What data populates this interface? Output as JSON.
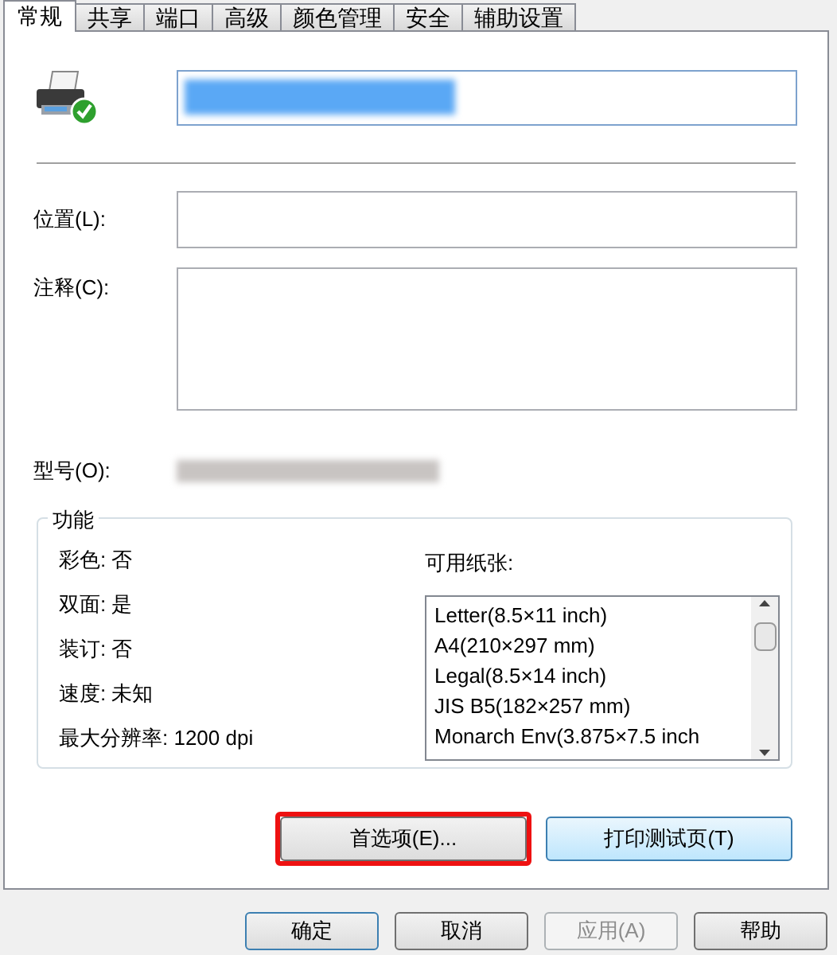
{
  "tabs": [
    {
      "label": "常规",
      "selected": true
    },
    {
      "label": "共享",
      "selected": false
    },
    {
      "label": "端口",
      "selected": false
    },
    {
      "label": "高级",
      "selected": false
    },
    {
      "label": "颜色管理",
      "selected": false
    },
    {
      "label": "安全",
      "selected": false
    },
    {
      "label": "辅助设置",
      "selected": false
    }
  ],
  "location": {
    "label": "位置(L):"
  },
  "comment": {
    "label": "注释(C):"
  },
  "model": {
    "label": "型号(O):"
  },
  "features": {
    "title": "功能",
    "items": [
      "彩色: 否",
      "双面: 是",
      "装订: 否",
      "速度: 未知",
      "最大分辨率: 1200 dpi"
    ],
    "paper_label": "可用纸张:",
    "paper_sizes": [
      "Letter(8.5×11 inch)",
      "A4(210×297 mm)",
      "Legal(8.5×14 inch)",
      "JIS B5(182×257 mm)",
      "Monarch Env(3.875×7.5 inch"
    ]
  },
  "panel_buttons": [
    {
      "label": "首选项(E)...",
      "highlighted": true
    },
    {
      "label": "打印测试页(T)",
      "highlighted": false
    }
  ],
  "dialog_buttons": [
    {
      "label": "确定",
      "disabled": false
    },
    {
      "label": "取消",
      "disabled": false
    },
    {
      "label": "应用(A)",
      "disabled": true
    },
    {
      "label": "帮助",
      "disabled": false
    }
  ]
}
